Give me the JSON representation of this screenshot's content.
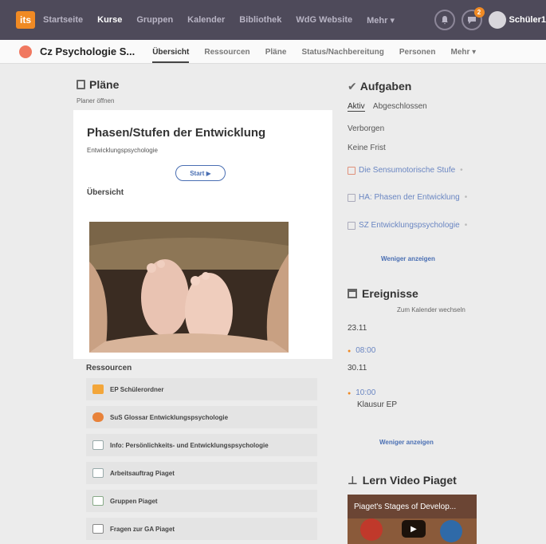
{
  "topbar": {
    "logo": "its",
    "nav": [
      "Startseite",
      "Kurse",
      "Gruppen",
      "Kalender",
      "Bibliothek",
      "WdG Website",
      "Mehr ▾"
    ],
    "badge": "2",
    "user": "Schüler1"
  },
  "course": {
    "title": "Cz Psychologie S...",
    "tabs": [
      "Übersicht",
      "Ressourcen",
      "Pläne",
      "Status/Nachbereitung",
      "Personen",
      "Mehr ▾"
    ]
  },
  "plaene": {
    "heading": "Pläne",
    "subtitle": "Planer öffnen",
    "card_title": "Phasen/Stufen der Entwicklung",
    "card_subtitle": "Entwicklungspsychologie",
    "start_label": "Start ▶",
    "overview_label": "Übersicht"
  },
  "ressourcen": {
    "heading": "Ressourcen",
    "items": [
      {
        "label": "EP Schülerordner",
        "icon": "folder-icon",
        "color": "#f3a63a"
      },
      {
        "label": "SuS Glossar Entwicklungspsychologie",
        "icon": "chat-icon",
        "color": "#e8823a"
      },
      {
        "label": "Info: Persönlichkeits- und Entwicklungspsychologie",
        "icon": "document-icon",
        "color": "#c9d3ea"
      },
      {
        "label": "Arbeitsauftrag Piaget",
        "icon": "document-icon",
        "color": "#c9d3ea"
      },
      {
        "label": "Gruppen Piaget",
        "icon": "checklist-icon",
        "color": "#d7e7bd"
      },
      {
        "label": "Fragen zur GA Piaget",
        "icon": "monitor-icon",
        "color": "#cccccc"
      }
    ]
  },
  "aufgaben": {
    "heading": "Aufgaben",
    "tab_active": "Aktiv",
    "tab_other": "Abgeschlossen",
    "hidden": "Verborgen",
    "no_deadline": "Keine Frist",
    "tasks": [
      "Die Sensumotorische Stufe",
      "HA: Phasen der Entwicklung",
      "SZ Entwicklungspsychologie"
    ],
    "less": "Weniger anzeigen"
  },
  "ereignisse": {
    "heading": "Ereignisse",
    "calendar_link": "Zum Kalender wechseln",
    "date1": "23.11",
    "time1": "08:00",
    "date2": "30.11",
    "time2": "10:00",
    "event2": "Klausur EP",
    "less": "Weniger anzeigen"
  },
  "video": {
    "heading": "Lern Video Piaget",
    "title": "Piaget's Stages of Develop..."
  },
  "colors": {
    "topbar": "#4e4a5a",
    "accent": "#f08a24",
    "link": "#4a6fb3"
  }
}
